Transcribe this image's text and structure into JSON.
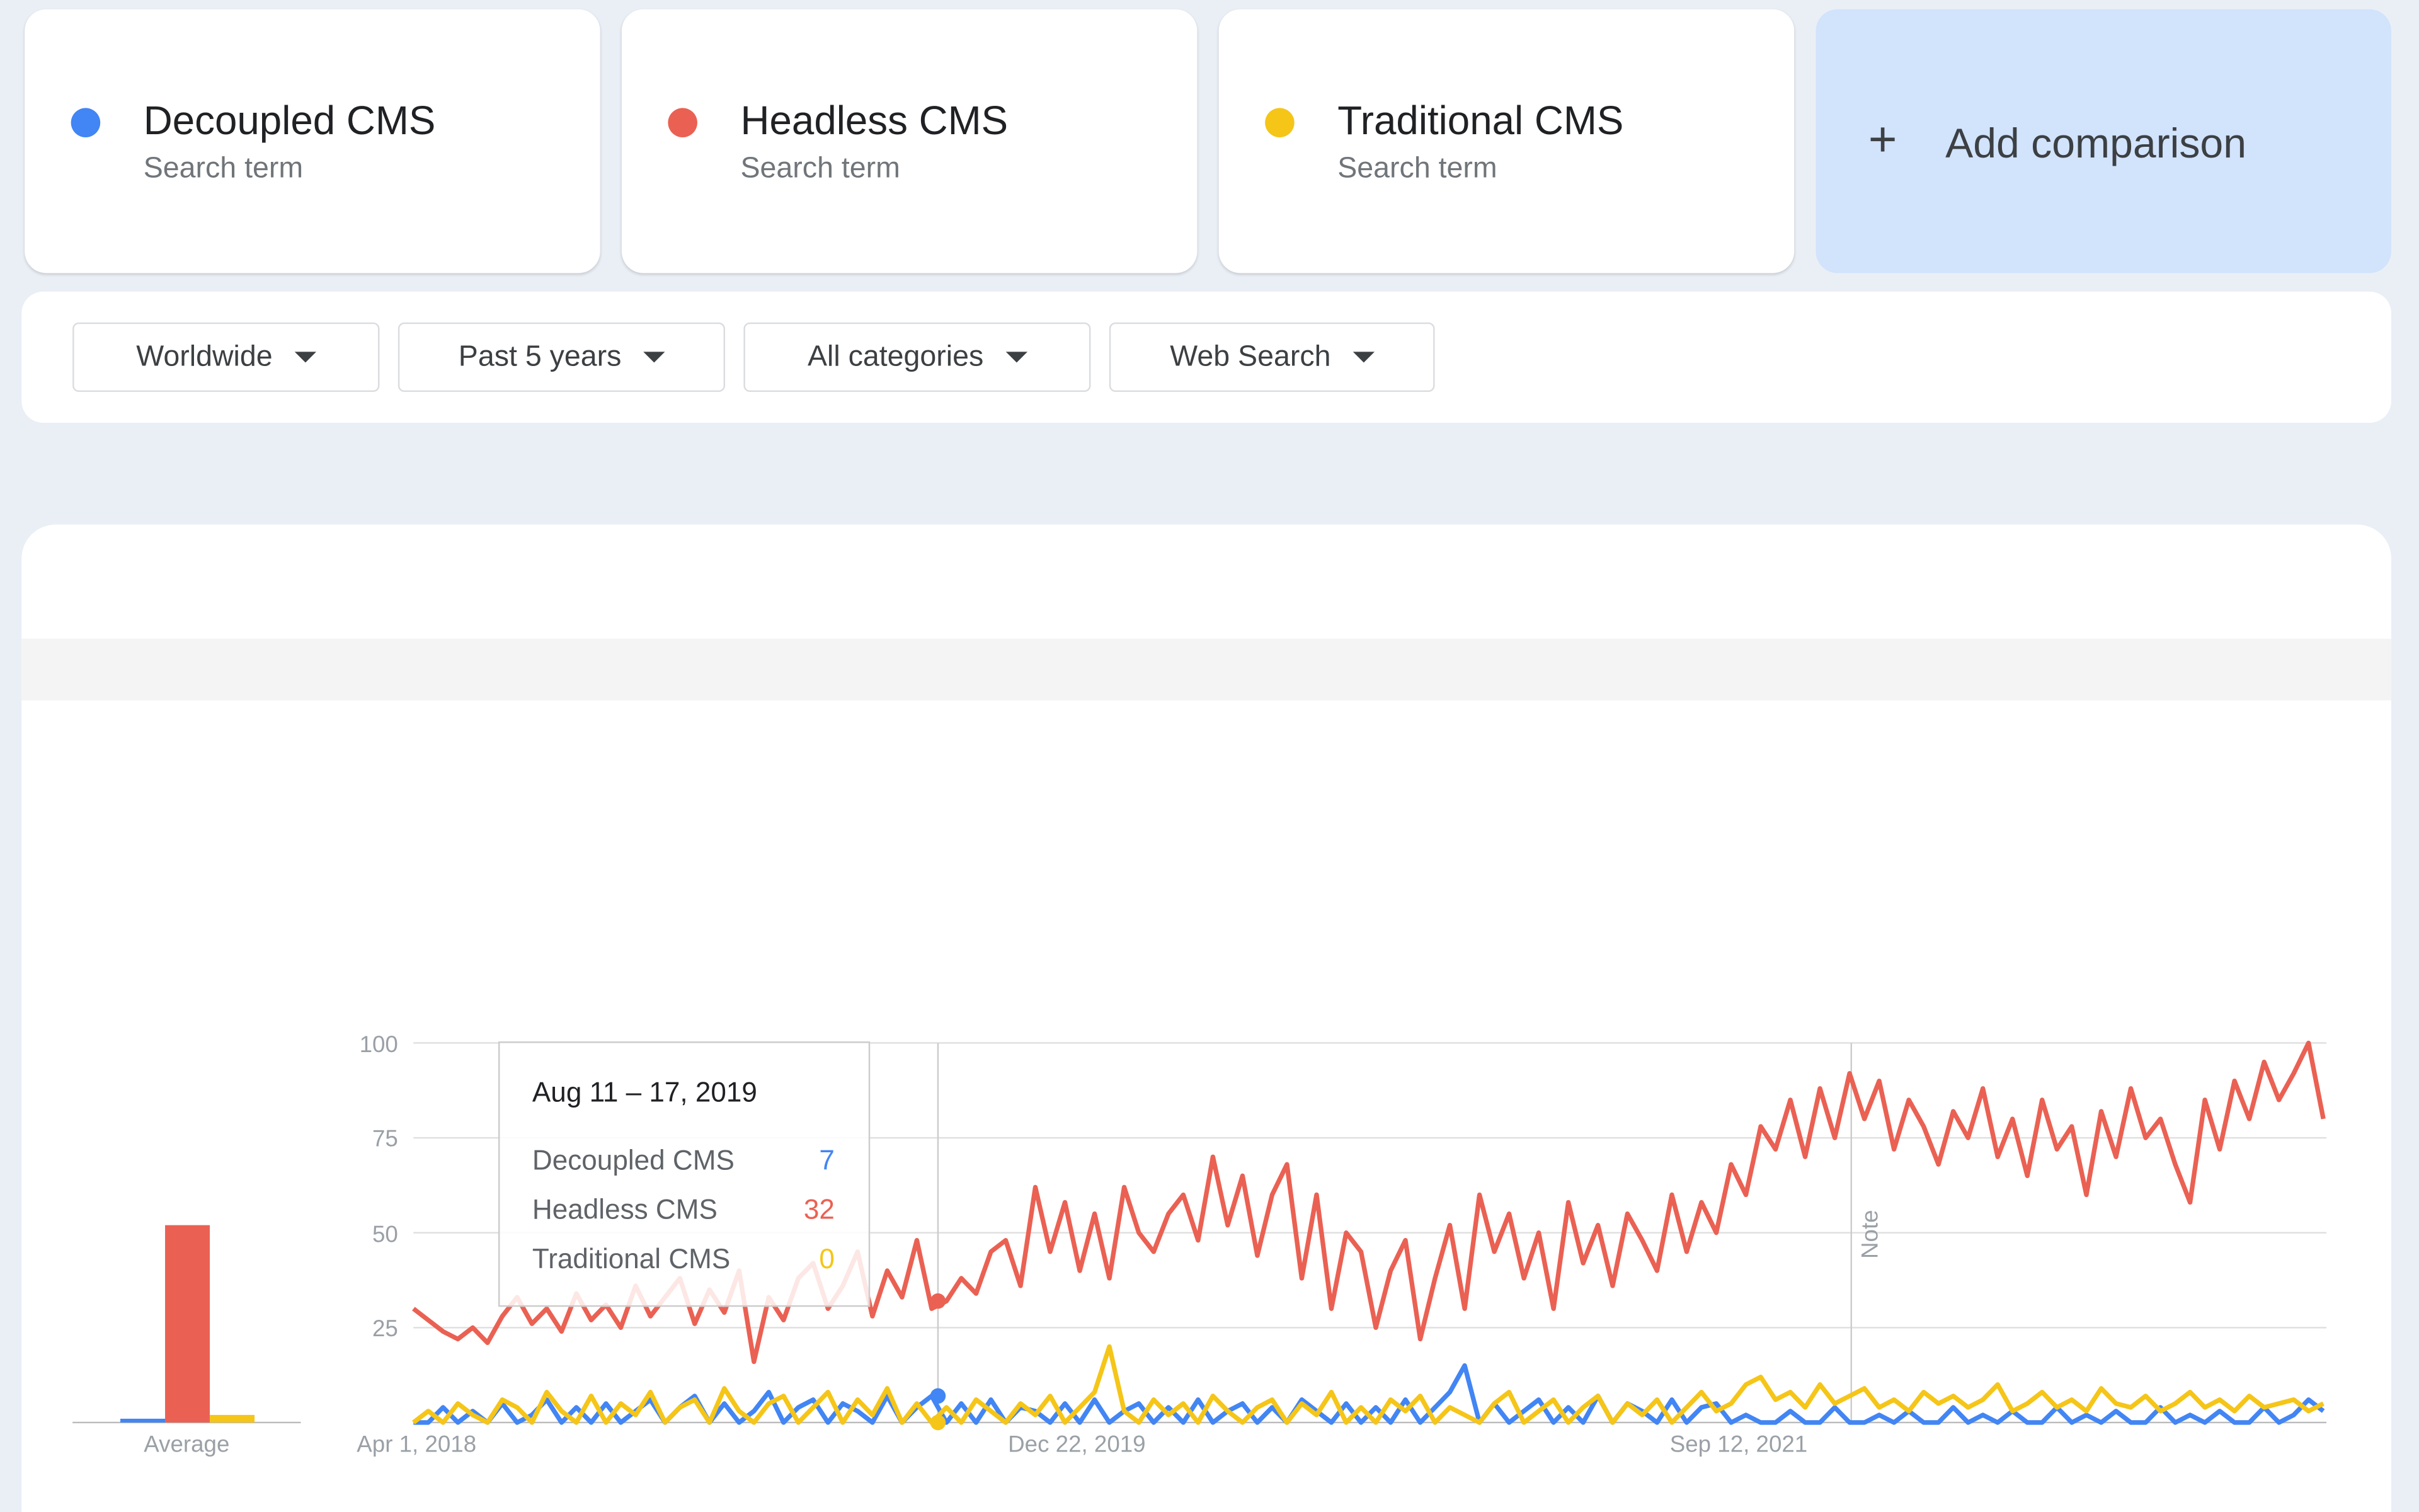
{
  "terms": [
    {
      "name": "Decoupled CMS",
      "type": "Search term",
      "color": "#4285f4"
    },
    {
      "name": "Headless CMS",
      "type": "Search term",
      "color": "#ea6153"
    },
    {
      "name": "Traditional CMS",
      "type": "Search term",
      "color": "#f5c518"
    }
  ],
  "add_comparison": {
    "icon": "plus-icon",
    "label": "Add comparison"
  },
  "filters": [
    {
      "label": "Worldwide"
    },
    {
      "label": "Past 5 years"
    },
    {
      "label": "All categories"
    },
    {
      "label": "Web Search"
    }
  ],
  "tooltip": {
    "date": "Aug 11 – 17, 2019",
    "rows": [
      {
        "name": "Decoupled CMS",
        "value": "7"
      },
      {
        "name": "Headless CMS",
        "value": "32"
      },
      {
        "name": "Traditional CMS",
        "value": "0"
      }
    ]
  },
  "chart_data": {
    "type": "line",
    "x_start": "2018-04-01",
    "x_interval": "2 weeks",
    "xticks": [
      "Apr 1, 2018",
      "Dec 22, 2019",
      "Sep 12, 2021"
    ],
    "yticks": [
      "100",
      "75",
      "50",
      "25"
    ],
    "ylim": [
      0,
      100
    ],
    "grid": true,
    "note_label": "Note",
    "average": {
      "label": "Average",
      "values": [
        1,
        52,
        2
      ]
    },
    "series": [
      {
        "name": "Decoupled CMS",
        "color": "#4285f4",
        "values": [
          0,
          0,
          4,
          0,
          3,
          0,
          5,
          0,
          2,
          6,
          0,
          4,
          0,
          5,
          0,
          3,
          6,
          0,
          4,
          7,
          0,
          5,
          0,
          3,
          8,
          0,
          4,
          6,
          0,
          5,
          3,
          0,
          7,
          0,
          4,
          7,
          0,
          5,
          0,
          6,
          0,
          4,
          3,
          0,
          5,
          0,
          6,
          0,
          3,
          5,
          0,
          4,
          0,
          6,
          0,
          3,
          5,
          0,
          4,
          0,
          6,
          3,
          0,
          5,
          0,
          4,
          0,
          6,
          0,
          4,
          8,
          15,
          0,
          5,
          0,
          3,
          6,
          0,
          4,
          0,
          7,
          0,
          5,
          3,
          0,
          6,
          0,
          4,
          5,
          0,
          2,
          0,
          0,
          3,
          0,
          0,
          4,
          0,
          0,
          2,
          0,
          3,
          0,
          0,
          4,
          0,
          2,
          0,
          3,
          0,
          0,
          4,
          0,
          2,
          0,
          3,
          0,
          0,
          4,
          0,
          2,
          0,
          3,
          0,
          0,
          4,
          0,
          2,
          6,
          3
        ]
      },
      {
        "name": "Headless CMS",
        "color": "#ea6153",
        "values": [
          30,
          27,
          24,
          22,
          25,
          21,
          28,
          33,
          26,
          30,
          24,
          34,
          27,
          31,
          25,
          36,
          28,
          33,
          38,
          26,
          35,
          29,
          40,
          16,
          33,
          27,
          38,
          42,
          30,
          36,
          45,
          28,
          40,
          33,
          48,
          30,
          32,
          38,
          34,
          45,
          48,
          36,
          62,
          45,
          58,
          40,
          55,
          38,
          62,
          50,
          45,
          55,
          60,
          48,
          70,
          52,
          65,
          44,
          60,
          68,
          38,
          60,
          30,
          50,
          45,
          25,
          40,
          48,
          22,
          38,
          52,
          30,
          60,
          45,
          55,
          38,
          50,
          30,
          58,
          42,
          52,
          36,
          55,
          48,
          40,
          60,
          45,
          58,
          50,
          68,
          60,
          78,
          72,
          85,
          70,
          88,
          75,
          92,
          80,
          90,
          72,
          85,
          78,
          68,
          82,
          75,
          88,
          70,
          80,
          65,
          85,
          72,
          78,
          60,
          82,
          70,
          88,
          75,
          80,
          68,
          58,
          85,
          72,
          90,
          80,
          95,
          85,
          92,
          100,
          80
        ]
      },
      {
        "name": "Traditional CMS",
        "color": "#f5c518",
        "values": [
          0,
          3,
          0,
          5,
          2,
          0,
          6,
          4,
          0,
          8,
          3,
          0,
          7,
          0,
          5,
          2,
          8,
          0,
          4,
          6,
          0,
          9,
          3,
          0,
          5,
          7,
          0,
          4,
          8,
          0,
          6,
          2,
          9,
          0,
          5,
          0,
          4,
          0,
          6,
          3,
          0,
          5,
          2,
          7,
          0,
          4,
          8,
          20,
          3,
          0,
          6,
          2,
          5,
          0,
          7,
          3,
          0,
          4,
          6,
          0,
          5,
          2,
          8,
          0,
          4,
          0,
          6,
          3,
          7,
          0,
          4,
          2,
          0,
          5,
          8,
          0,
          3,
          6,
          0,
          4,
          7,
          0,
          5,
          2,
          6,
          0,
          4,
          8,
          3,
          5,
          10,
          12,
          6,
          8,
          4,
          10,
          5,
          7,
          9,
          4,
          6,
          3,
          8,
          5,
          7,
          4,
          6,
          10,
          3,
          5,
          8,
          4,
          6,
          3,
          9,
          5,
          4,
          7,
          3,
          5,
          8,
          4,
          6,
          3,
          7,
          4,
          5,
          6,
          3,
          5
        ]
      }
    ]
  }
}
